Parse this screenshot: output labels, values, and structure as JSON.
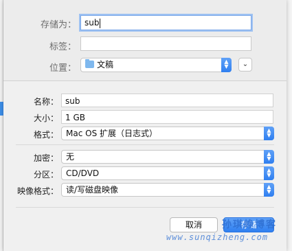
{
  "save_as": {
    "label": "存储为：",
    "value": "sub"
  },
  "tags": {
    "label": "标签：",
    "value": ""
  },
  "location": {
    "label": "位置：",
    "value": "文稿",
    "icon": "folder-icon",
    "expand_icon": "chevron-down-icon"
  },
  "name": {
    "label": "名称：",
    "value": "sub"
  },
  "size": {
    "label": "大小：",
    "value": "1 GB"
  },
  "format": {
    "label": "格式：",
    "value": "Mac OS 扩展（日志式）"
  },
  "encryption": {
    "label": "加密：",
    "value": "无"
  },
  "partition": {
    "label": "分区：",
    "value": "CD/DVD"
  },
  "image_format": {
    "label": "映像格式：",
    "value": "读/写磁盘映像"
  },
  "buttons": {
    "cancel": "取消",
    "save": "存储"
  },
  "watermark": {
    "text": "孙琪峥博客",
    "url": "www.sunqizheng.com"
  },
  "colors": {
    "accent": "#2f7ff0",
    "focus_ring": "#9ec2f2"
  }
}
